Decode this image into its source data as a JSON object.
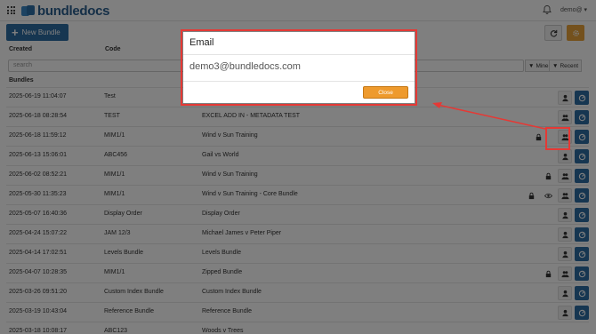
{
  "header": {
    "app_name": "bundledocs",
    "user": "demo@ ▾"
  },
  "toolbar": {
    "new_bundle_label": "New Bundle"
  },
  "table": {
    "col_created": "Created",
    "col_code": "Code",
    "search_placeholder": "search",
    "filter_mine": "Mine",
    "filter_recent": "Recent",
    "section_title": "Bundles",
    "rows": [
      {
        "created": "2025-06-19 11:04:07",
        "code": "Test",
        "name": ""
      },
      {
        "created": "2025-06-18 08:28:54",
        "code": "TEST",
        "name": "EXCEL ADD IN - METADATA TEST"
      },
      {
        "created": "2025-06-18 11:59:12",
        "code": "MIM1/1",
        "name": "Wind v Sun Training"
      },
      {
        "created": "2025-06-13 15:06:01",
        "code": "ABC456",
        "name": "Gail vs World"
      },
      {
        "created": "2025-06-02 08:52:21",
        "code": "MIM1/1",
        "name": "Wind v Sun Training"
      },
      {
        "created": "2025-05-30 11:35:23",
        "code": "MIM1/1",
        "name": "Wind v Sun Training - Core Bundle"
      },
      {
        "created": "2025-05-07 16:40:36",
        "code": "Display Order",
        "name": "Display Order"
      },
      {
        "created": "2025-04-24 15:07:22",
        "code": "JAM 12/3",
        "name": "Michael James v Peter Piper"
      },
      {
        "created": "2025-04-14 17:02:51",
        "code": "Levels Bundle",
        "name": "Levels Bundle"
      },
      {
        "created": "2025-04-07 10:28:35",
        "code": "MIM1/1",
        "name": "Zipped Bundle"
      },
      {
        "created": "2025-03-26 09:51:20",
        "code": "Custom Index Bundle",
        "name": "Custom Index Bundle"
      },
      {
        "created": "2025-03-19 10:43:04",
        "code": "Reference Bundle",
        "name": "Reference Bundle"
      },
      {
        "created": "2025-03-18 10:08:17",
        "code": "ABC123",
        "name": "Woods v Trees"
      }
    ]
  },
  "modal": {
    "title": "Email",
    "email": "demo3@bundledocs.com",
    "close_label": "Close"
  },
  "colors": {
    "brand": "#2d6ca2",
    "accent": "#ee9a2d",
    "annotation": "#e53935"
  }
}
